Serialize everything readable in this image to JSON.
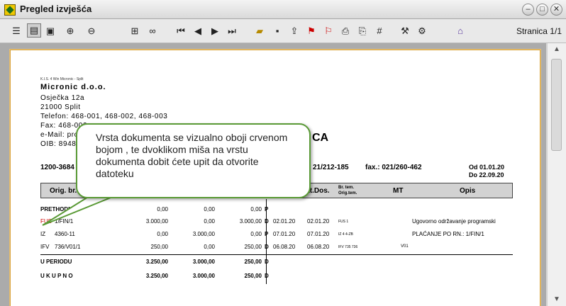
{
  "window": {
    "title": "Pregled izvješća"
  },
  "toolbar": {
    "page_info": "Stranica 1/1",
    "icons": [
      "page-view-icon",
      "outline-view-icon",
      "two-page-icon",
      "zoom-in-icon",
      "zoom-out-icon",
      "tree-icon",
      "find-binoculars-icon",
      "first-page-icon",
      "prev-page-icon",
      "next-page-icon",
      "last-page-icon",
      "open-folder-icon",
      "save-disk-icon",
      "export-icon",
      "pdf-icon",
      "pdf-alt-icon",
      "print-icon",
      "print-setup-icon",
      "calculator-icon",
      "tools-icon",
      "settings-icon",
      "exit-icon"
    ]
  },
  "report": {
    "header_small": "K.I.S. 4 Win Micronic - Split",
    "company": "Micronic d.o.o.",
    "address": [
      "Osječka 12a",
      "21000 Split",
      "Telefon: 468-001, 468-002, 468-003",
      "Fax: 468-003",
      "e-Mail: prod",
      "OIB: 89489"
    ],
    "title_fragment": "CA",
    "account": "1200-3684",
    "phone_fragment": "21/212-185",
    "fax": "fax.: 021/260-462",
    "period_from": "Od 01.01.20",
    "period_to": "Do 22.09.20",
    "columns": {
      "orig": "Orig. br. do",
      "dat_dos": "Dat.Dos.",
      "br_tem": "Br. tem.",
      "orig_tem": "Orig.tem.",
      "mt": "MT",
      "opis": "Opis"
    },
    "rows": [
      {
        "doc": "PRETHODN",
        "num": "",
        "dug": "0,00",
        "pot": "0,00",
        "saldo": "0,00",
        "dp": "P",
        "date1": "",
        "date2": "",
        "tem": "",
        "mt": "",
        "opis": ""
      },
      {
        "doc": "FUS",
        "num": "1/FIN/1",
        "dug": "3.000,00",
        "pot": "0,00",
        "saldo": "3.000,00",
        "dp": "D",
        "date1": "02.01.20",
        "date2": "02.01.20",
        "tem": "FUS 1",
        "mt": "",
        "opis": "Ugovorno održavanje programski"
      },
      {
        "doc": "IZ",
        "num": "4360-11",
        "dug": "0,00",
        "pot": "3.000,00",
        "saldo": "0,00",
        "dp": "P",
        "date1": "07.01.20",
        "date2": "07.01.20",
        "tem": "IZ 4 4-ZB",
        "mt": "",
        "opis": "PLAĆANJE PO RN.: 1/FIN/1"
      },
      {
        "doc": "IFV",
        "num": "736/V01/1",
        "dug": "250,00",
        "pot": "0,00",
        "saldo": "250,00",
        "dp": "D",
        "date1": "06.08.20",
        "date2": "06.08.20",
        "tem": "IFV 735 736",
        "mt": "V01",
        "opis": ""
      }
    ],
    "totals": [
      {
        "label": "U PERIODU",
        "dug": "3.250,00",
        "pot": "3.000,00",
        "saldo": "250,00",
        "dp": "D"
      },
      {
        "label": "U K U P N O",
        "dug": "3.250,00",
        "pot": "3.000,00",
        "saldo": "250,00",
        "dp": "D"
      }
    ]
  },
  "callout": {
    "text": "Vrsta dokumenta se vizualno oboji crvenom bojom , te dvoklikom miša na vrstu dokumenta dobit ćete upit da otvorite datoteku"
  },
  "colors": {
    "doc_type_highlight": "#d00000",
    "callout_border": "#5a9a36",
    "page_border": "#d9a23a"
  }
}
